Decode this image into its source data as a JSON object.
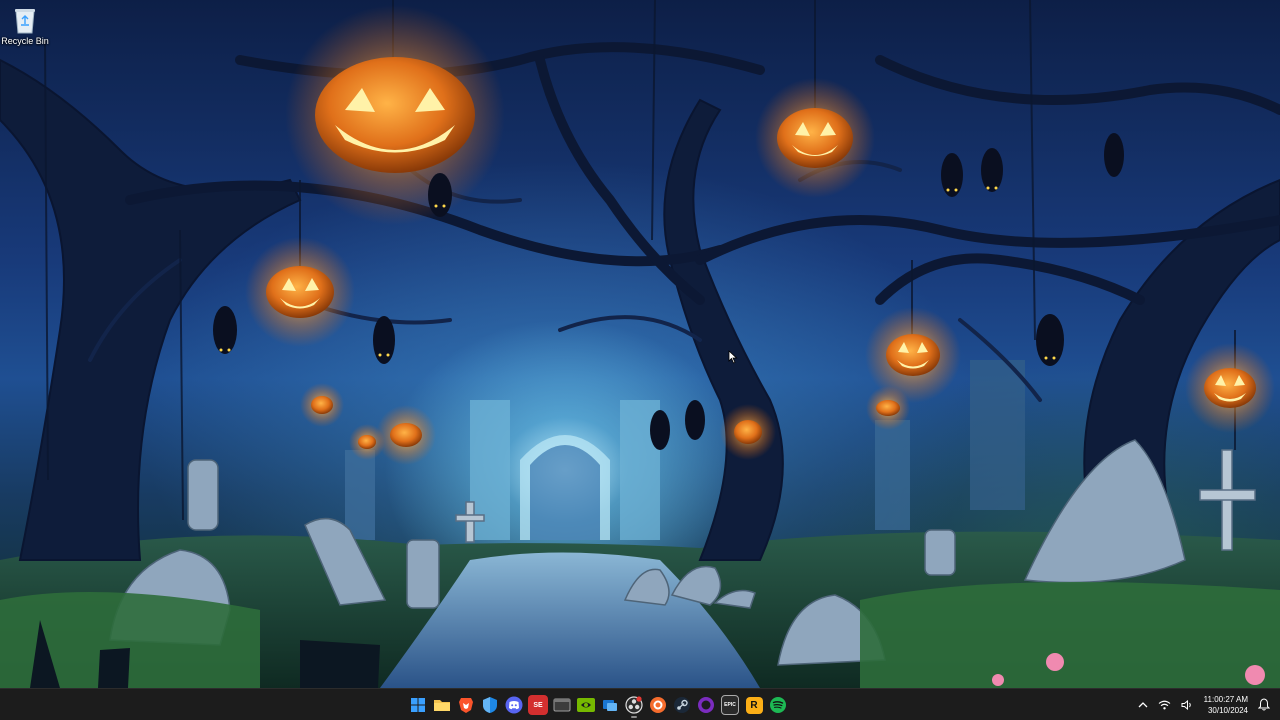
{
  "desktop": {
    "icons": [
      {
        "label": "Recycle Bin",
        "icon": "recycle-bin-icon"
      }
    ]
  },
  "taskbar": {
    "apps": [
      {
        "name": "start",
        "icon": "windows-start-icon",
        "color": "#3aa0ff"
      },
      {
        "name": "file-explorer",
        "icon": "folder-icon",
        "color": "#f2c14e"
      },
      {
        "name": "brave",
        "icon": "brave-lion-icon",
        "color": "#fb542b"
      },
      {
        "name": "windows-security",
        "icon": "shield-icon",
        "color": "#1e88e5"
      },
      {
        "name": "discord",
        "icon": "discord-icon",
        "color": "#5865f2"
      },
      {
        "name": "app-red",
        "icon": "se-app-icon",
        "color": "#d32f2f",
        "text": "SE"
      },
      {
        "name": "app-gray",
        "icon": "window-app-icon",
        "color": "#4a4a4a"
      },
      {
        "name": "nvidia",
        "icon": "nvidia-icon",
        "color": "#76b900"
      },
      {
        "name": "app-blue",
        "icon": "remote-app-icon",
        "color": "#1976d2"
      },
      {
        "name": "obs",
        "icon": "obs-icon",
        "color": "#2b2b2b"
      },
      {
        "name": "origin",
        "icon": "origin-icon",
        "color": "#f56c2d"
      },
      {
        "name": "steam",
        "icon": "steam-icon",
        "color": "#1b2838"
      },
      {
        "name": "app-purple",
        "icon": "circle-app-icon",
        "color": "#7b2cbf"
      },
      {
        "name": "epic",
        "icon": "epic-games-icon",
        "color": "#2a2a2a",
        "text": "EPIC"
      },
      {
        "name": "rockstar",
        "icon": "rockstar-icon",
        "color": "#fcaf17",
        "text": "R"
      },
      {
        "name": "spotify",
        "icon": "spotify-icon",
        "color": "#1db954"
      }
    ],
    "tray": {
      "icons": [
        "chevron-up-icon",
        "wifi-icon",
        "speaker-icon"
      ],
      "time": "11:00:27 AM",
      "date": "30/10/2024",
      "notification_icon": "bell-icon"
    }
  }
}
